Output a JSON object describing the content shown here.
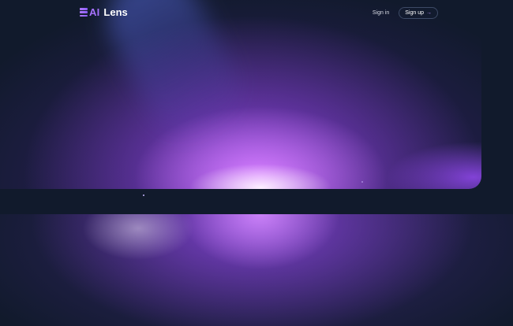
{
  "brand": {
    "logo_ai": "AI",
    "logo_name": "Lens"
  },
  "nav": {
    "signin_label": "Sign in",
    "signup_label": "Sign up",
    "signup_arrow": "→"
  },
  "colors": {
    "background": "#111a2c",
    "accent": "#a772ff",
    "glow": "#b060ff"
  }
}
